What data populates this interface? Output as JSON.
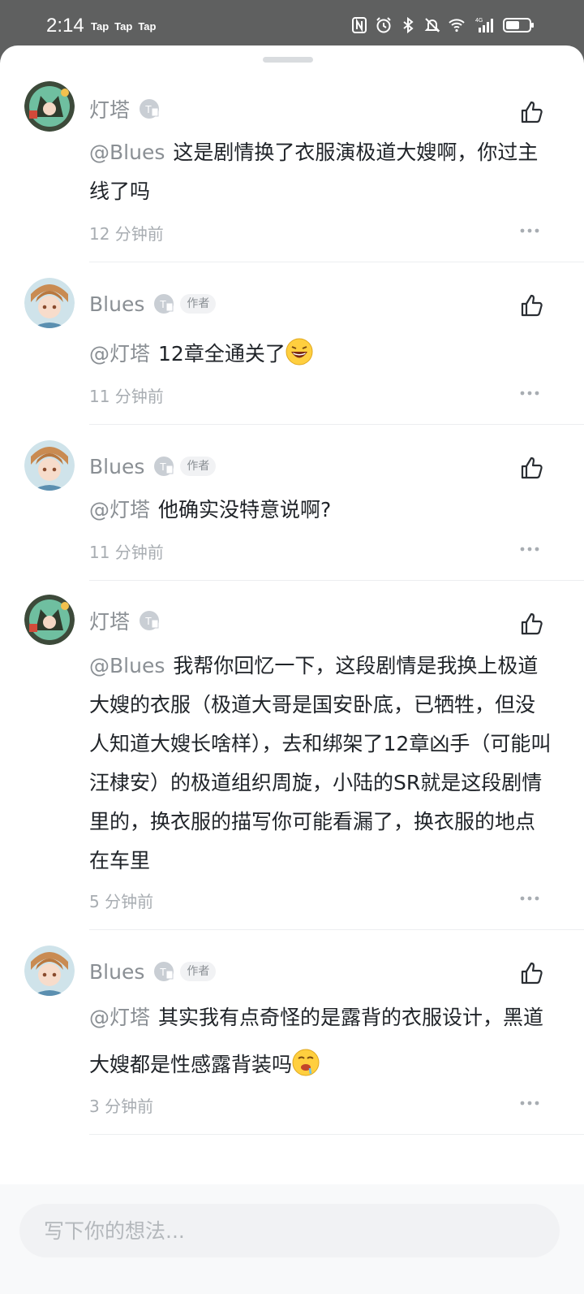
{
  "status_bar": {
    "time": "2:14",
    "app_notifications": [
      "Tap",
      "Tap",
      "Tap"
    ],
    "network_label": "4G",
    "icons": [
      "nfc-icon",
      "alarm-icon",
      "bluetooth-icon",
      "mute-icon",
      "wifi-icon",
      "signal-icon",
      "battery-icon"
    ]
  },
  "comments": [
    {
      "author": "灯塔",
      "is_author": false,
      "author_tag": "",
      "mention": "@Blues",
      "text": "这是剧情换了衣服演极道大嫂啊，你过主线了吗",
      "time": "12 分钟前",
      "emoji": ""
    },
    {
      "author": "Blues",
      "is_author": true,
      "author_tag": "作者",
      "mention": "@灯塔",
      "text": "12章全通关了",
      "time": "11 分钟前",
      "emoji": "grinning-emoji"
    },
    {
      "author": "Blues",
      "is_author": true,
      "author_tag": "作者",
      "mention": "@灯塔",
      "text": "他确实没特意说啊?",
      "time": "11 分钟前",
      "emoji": ""
    },
    {
      "author": "灯塔",
      "is_author": false,
      "author_tag": "",
      "mention": "@Blues",
      "text": "我帮你回忆一下，这段剧情是我换上极道大嫂的衣服（极道大哥是国安卧底，已牺牲，但没人知道大嫂长啥样），去和绑架了12章凶手（可能叫汪棣安）的极道组织周旋，小陆的SR就是这段剧情里的，换衣服的描写你可能看漏了，换衣服的地点在车里",
      "time": "5 分钟前",
      "emoji": ""
    },
    {
      "author": "Blues",
      "is_author": true,
      "author_tag": "作者",
      "mention": "@灯塔",
      "text": "其实我有点奇怪的是露背的衣服设计，黑道大嫂都是性感露背装吗",
      "time": "3 分钟前",
      "emoji": "drooling-emoji"
    }
  ],
  "composer": {
    "placeholder": "写下你的想法..."
  },
  "colors": {
    "text_primary": "#1f2328",
    "text_secondary": "#8a8f94",
    "divider": "#eceef0",
    "status_bar_bg": "#5f6060"
  }
}
